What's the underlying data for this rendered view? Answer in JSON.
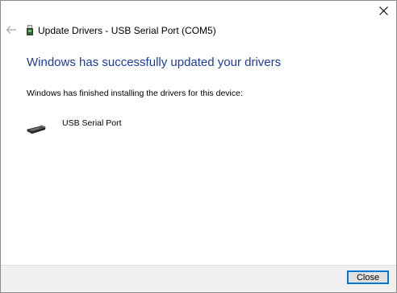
{
  "window": {
    "title": "Update Drivers - USB Serial Port (COM5)",
    "close_icon": "close-x-icon",
    "back_icon": "back-arrow-icon"
  },
  "main": {
    "headline": "Windows has successfully updated your drivers",
    "message": "Windows has finished installing the drivers for this device:",
    "device": {
      "icon": "usb-serial-device-icon",
      "name": "USB Serial Port"
    }
  },
  "footer": {
    "close_label": "Close"
  },
  "colors": {
    "headline": "#1e3c96",
    "button_border": "#0078d7",
    "footer_bg": "#f0f0f0"
  }
}
